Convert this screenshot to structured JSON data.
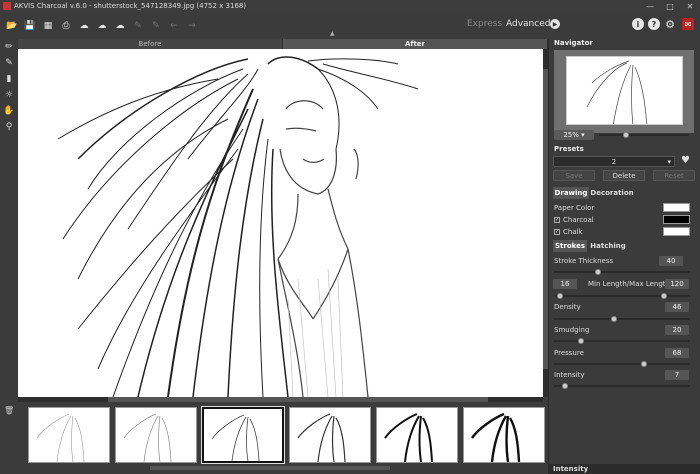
{
  "title": "AKVIS Charcoal v.6.0 - shutterstock_547128349.jpg (4752 x 3168)",
  "modes": {
    "express": "Express",
    "advanced": "Advanced"
  },
  "tabs": {
    "before": "Before",
    "after": "After"
  },
  "navigator": {
    "title": "Navigator",
    "zoom": "25%"
  },
  "presets": {
    "title": "Presets",
    "selected": "2",
    "save": "Save",
    "delete": "Delete",
    "reset": "Reset"
  },
  "subtabs": {
    "drawing": "Drawing",
    "decoration": "Decoration",
    "strokes": "Strokes",
    "hatching": "Hatching"
  },
  "colors": {
    "paper_label": "Paper Color",
    "paper": "#ffffff",
    "charcoal_label": "Charcoal",
    "charcoal": "#000000",
    "chalk_label": "Chalk",
    "chalk": "#ffffff"
  },
  "params": {
    "stroke_thickness_label": "Stroke Thickness",
    "stroke_thickness": "40",
    "min_length": "16",
    "length_label": "Min Length/Max Length",
    "max_length": "120",
    "density_label": "Density",
    "density": "46",
    "smudging_label": "Smudging",
    "smudging": "20",
    "pressure_label": "Pressure",
    "pressure": "68",
    "intensity_label": "Intensity",
    "intensity": "7"
  },
  "bottom_section": "Intensity"
}
